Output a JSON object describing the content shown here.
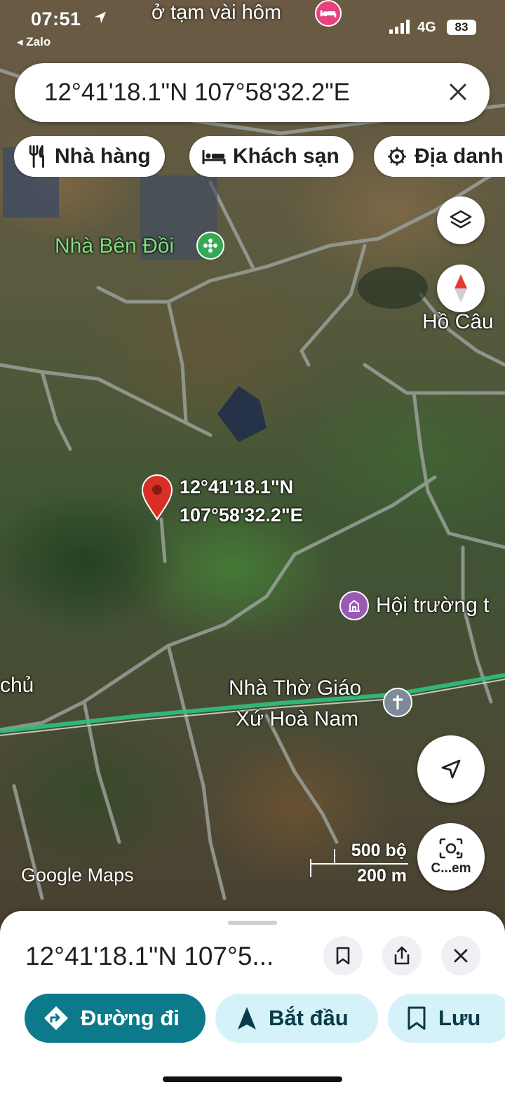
{
  "status_bar": {
    "time": "07:51",
    "back_app": "◂ Zalo",
    "network": "4G",
    "battery": "83"
  },
  "map": {
    "top_place_label": "ở tạm vài hôm",
    "labels": {
      "nha_ben_doi": "Nhà Bên Đồi",
      "ho_cau": "Hồ Câu",
      "hoi_truong": "Hội trường t",
      "nha_tho_line1": "Nhà Thờ Giáo",
      "nha_tho_line2": "Xứ Hoà Nam",
      "chu": "chủ"
    },
    "dropped_pin": {
      "lat": "12°41'18.1\"N",
      "lng": "107°58'32.2\"E"
    },
    "watermark": "Google Maps",
    "scale": {
      "imperial": "500 bộ",
      "metric": "200 m"
    },
    "lens_button_label": "C...em"
  },
  "search": {
    "value": "12°41'18.1\"N 107°58'32.2\"E",
    "close_icon": "close-icon"
  },
  "chips": [
    {
      "label": "Nhà hàng",
      "icon": "restaurant-icon"
    },
    {
      "label": "Khách sạn",
      "icon": "hotel-icon"
    },
    {
      "label": "Địa danh",
      "icon": "landmark-icon"
    }
  ],
  "sheet": {
    "title": "12°41'18.1\"N 107°5...",
    "actions": {
      "directions": "Đường đi",
      "start": "Bắt đầu",
      "save": "Lưu"
    }
  },
  "colors": {
    "accent": "#0c7a8b",
    "accent_light": "#d4f2f8",
    "pin_red": "#d93025",
    "poi_green": "#34a853",
    "poi_purple": "#9b59b6",
    "poi_gray": "#7d8b99",
    "hotel_pink": "#e8417c"
  }
}
